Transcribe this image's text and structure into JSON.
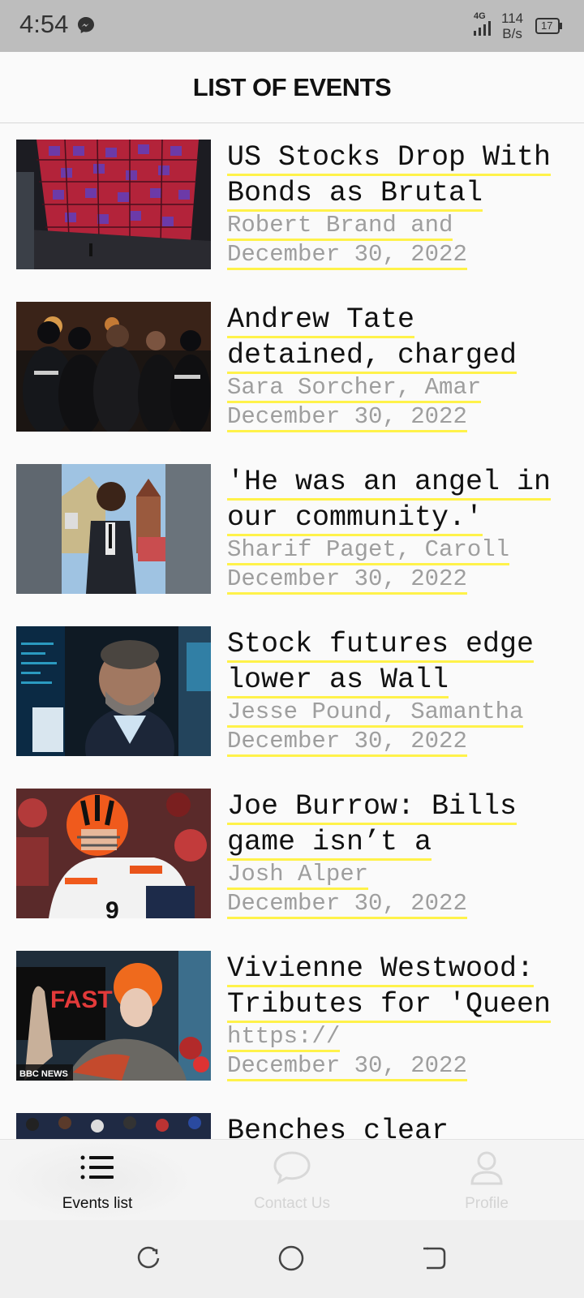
{
  "status_bar": {
    "time": "4:54",
    "network_type": "4G",
    "net_speed_value": "114",
    "net_speed_unit": "B/s",
    "battery": "17"
  },
  "header": {
    "title": "LIST OF EVENTS"
  },
  "events": [
    {
      "title_line1": "US Stocks Drop With",
      "title_line2": "Bonds as Brutal",
      "author": "Robert Brand and",
      "date": "December 30, 2022"
    },
    {
      "title_line1": "Andrew Tate",
      "title_line2": "detained, charged",
      "author": "Sara Sorcher, Amar",
      "date": "December 30, 2022"
    },
    {
      "title_line1": "'He was an angel in",
      "title_line2": "our community.'",
      "author": "Sharif Paget, Caroll",
      "date": "December 30, 2022"
    },
    {
      "title_line1": "Stock futures edge",
      "title_line2": "lower as Wall",
      "author": "Jesse Pound, Samantha",
      "date": "December 30, 2022"
    },
    {
      "title_line1": "Joe Burrow: Bills",
      "title_line2": "game isn’t a",
      "author": "Josh Alper",
      "date": "December 30, 2022"
    },
    {
      "title_line1": "Vivienne Westwood:",
      "title_line2": "Tributes for 'Queen",
      "author": "https://",
      "date": "December 30, 2022"
    },
    {
      "title_line1": "Benches clear",
      "title_line2": "",
      "author": "",
      "date": ""
    }
  ],
  "thumb_text": {
    "fast": "FAST",
    "bbc": "BBC NEWS"
  },
  "bottom_nav": {
    "events": "Events list",
    "contact": "Contact Us",
    "profile": "Profile"
  }
}
